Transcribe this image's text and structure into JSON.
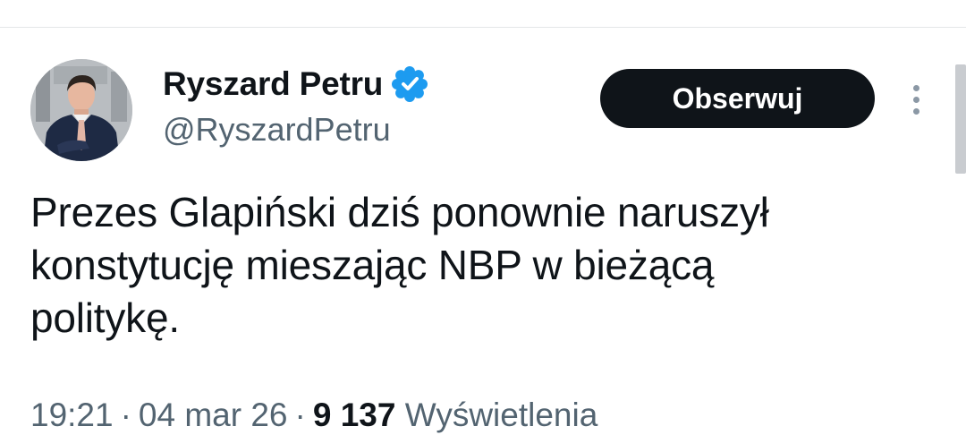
{
  "post": {
    "author": {
      "display_name": "Ryszard Petru",
      "handle": "@RyszardPetru",
      "verified": true,
      "verified_color": "#1d9bf0"
    },
    "follow_label": "Obserwuj",
    "text_lines": [
      "Prezes Glapiński dziś ponownie naruszył",
      "konstytucję mieszając NBP w bieżącą",
      "politykę."
    ],
    "meta": {
      "time": "19:21",
      "separator": "·",
      "date": "04 mar 26",
      "views_count": "9 137",
      "views_label": "Wyświetlenia"
    }
  },
  "icons": {
    "verified": "verified-badge-icon",
    "more": "more-vertical-icon"
  },
  "colors": {
    "text_primary": "#0f1419",
    "text_secondary": "#536471",
    "button_bg": "#0f1419",
    "button_text": "#ffffff"
  }
}
